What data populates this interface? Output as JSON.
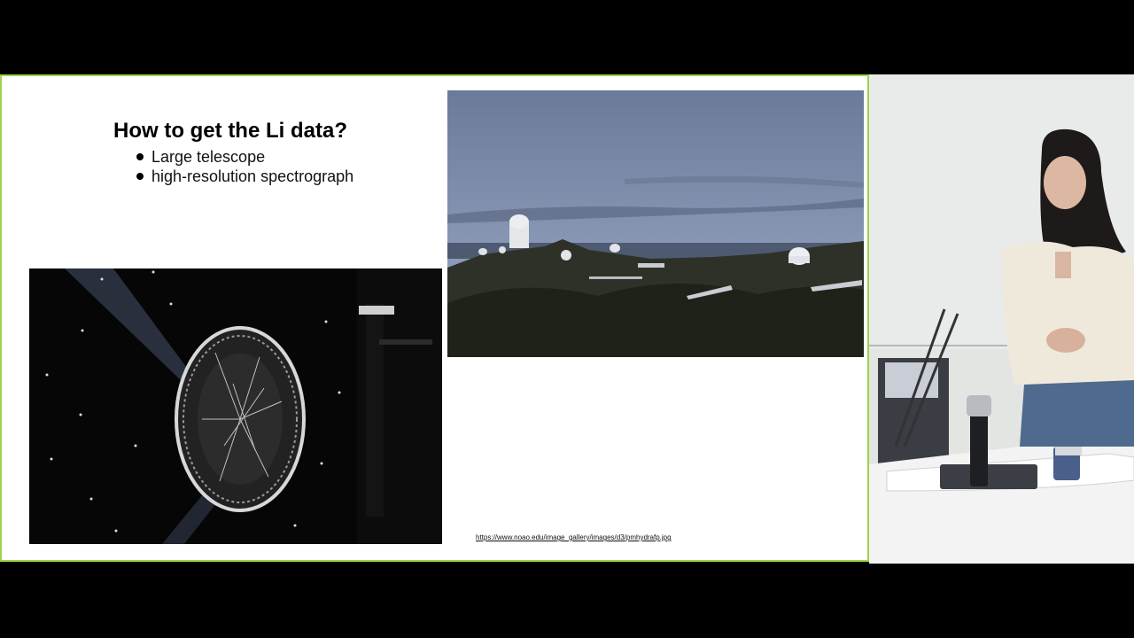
{
  "slide": {
    "title": "How to get the Li data?",
    "bullets": [
      {
        "label": "Large telescope"
      },
      {
        "label": "high-resolution spectrograph"
      }
    ],
    "source_link": "https://www.noao.edu/image_gallery/images/d3/pmhydrafp.jpg"
  },
  "colors": {
    "slide_border": "#9fd34a",
    "letterbox": "#000000"
  }
}
